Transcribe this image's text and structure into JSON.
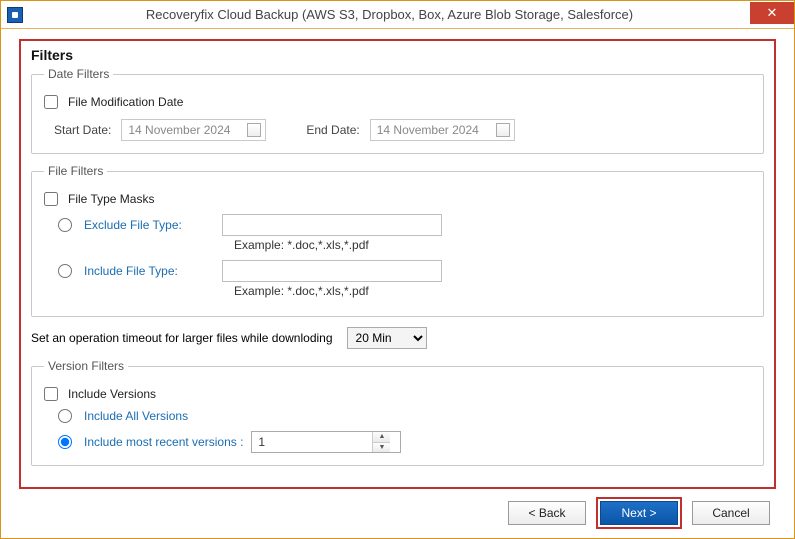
{
  "window": {
    "title": "Recoveryfix Cloud Backup (AWS S3, Dropbox, Box, Azure Blob Storage, Salesforce)"
  },
  "filters": {
    "heading": "Filters",
    "dateFilters": {
      "legend": "Date Filters",
      "fileModDate": {
        "label": "File Modification Date",
        "checked": false
      },
      "startDate": {
        "label": "Start Date:",
        "value": "14 November 2024"
      },
      "endDate": {
        "label": "End Date:",
        "value": "14 November 2024"
      }
    },
    "fileFilters": {
      "legend": "File Filters",
      "fileTypeMasks": {
        "label": "File Type Masks",
        "checked": false
      },
      "excludeLabel": "Exclude File Type:",
      "excludeValue": "",
      "excludeExample": "Example:  *.doc,*.xls,*.pdf",
      "includeLabel": "Include File Type:",
      "includeValue": "",
      "includeExample": "Example:  *.doc,*.xls,*.pdf"
    },
    "timeout": {
      "label": "Set an operation timeout for larger files while downloding",
      "selected": "20 Min",
      "options": [
        "20 Min"
      ]
    },
    "versionFilters": {
      "legend": "Version Filters",
      "includeVersions": {
        "label": "Include Versions",
        "checked": false
      },
      "allVersions": {
        "label": "Include All Versions",
        "selected": false
      },
      "mostRecent": {
        "label": "Include most recent versions :",
        "selected": true,
        "count": "1"
      }
    }
  },
  "footer": {
    "back": "< Back",
    "next": "Next >",
    "cancel": "Cancel"
  }
}
